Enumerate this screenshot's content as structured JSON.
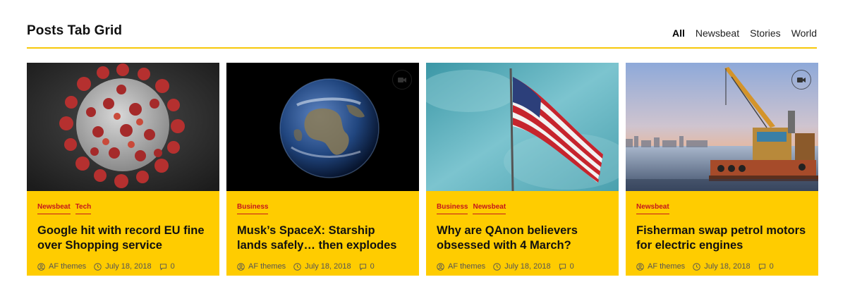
{
  "section": {
    "title": "Posts Tab Grid",
    "tabs": [
      "All",
      "Newsbeat",
      "Stories",
      "World"
    ],
    "active_tab": "All"
  },
  "colors": {
    "accent": "#ffcc00",
    "category": "#c4161c",
    "rule": "#f7c80a"
  },
  "cards": [
    {
      "image": "coronavirus",
      "video": false,
      "categories": [
        "Newsbeat",
        "Tech"
      ],
      "headline": "Google hit with record EU fine over Shopping service",
      "author": "AF themes",
      "date": "July 18, 2018",
      "comments": "0"
    },
    {
      "image": "earth",
      "video": true,
      "categories": [
        "Business"
      ],
      "headline": "Musk’s SpaceX: Starship lands safely… then explodes",
      "author": "AF themes",
      "date": "July 18, 2018",
      "comments": "0"
    },
    {
      "image": "us-flag",
      "video": false,
      "categories": [
        "Business",
        "Newsbeat"
      ],
      "headline": "Why are QAnon believers obsessed with 4 March?",
      "author": "AF themes",
      "date": "July 18, 2018",
      "comments": "0"
    },
    {
      "image": "crane-barge",
      "video": true,
      "categories": [
        "Newsbeat"
      ],
      "headline": "Fisherman swap petrol motors for electric engines",
      "author": "AF themes",
      "date": "July 18, 2018",
      "comments": "0"
    }
  ]
}
